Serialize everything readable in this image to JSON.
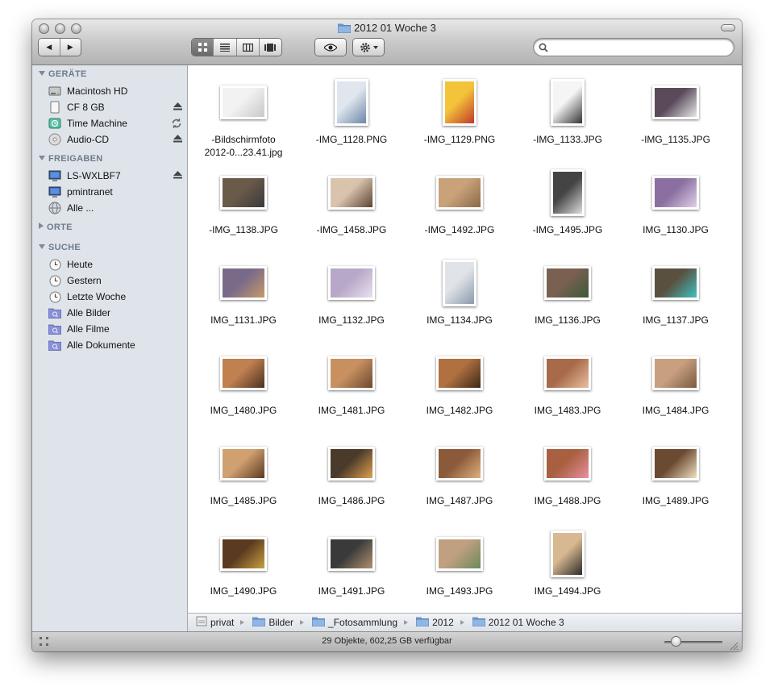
{
  "window": {
    "title": "2012 01 Woche 3",
    "search_placeholder": ""
  },
  "toolbar": {
    "back_glyph": "◀",
    "forward_glyph": "▶",
    "views": [
      "icon-view",
      "list-view",
      "column-view",
      "coverflow-view"
    ],
    "active_view": "icon-view",
    "quicklook_icon": "eye-icon",
    "action_icon": "gear-icon"
  },
  "sidebar": {
    "sections": [
      {
        "title": "GERÄTE",
        "expanded": true,
        "items": [
          {
            "label": "Macintosh HD",
            "icon": "harddisk-icon"
          },
          {
            "label": "CF 8 GB",
            "icon": "disk-icon",
            "accessory": "eject-icon"
          },
          {
            "label": "Time Machine",
            "icon": "timemachine-icon",
            "accessory": "sync-icon"
          },
          {
            "label": "Audio-CD",
            "icon": "cd-icon",
            "accessory": "eject-icon"
          }
        ]
      },
      {
        "title": "FREIGABEN",
        "expanded": true,
        "items": [
          {
            "label": "LS-WXLBF7",
            "icon": "network-display-icon",
            "accessory": "eject-icon"
          },
          {
            "label": "pmintranet",
            "icon": "network-display-icon"
          },
          {
            "label": "Alle ...",
            "icon": "network-globe-icon"
          }
        ]
      },
      {
        "title": "ORTE",
        "expanded": false,
        "items": []
      },
      {
        "title": "SUCHE",
        "expanded": true,
        "items": [
          {
            "label": "Heute",
            "icon": "clock-icon"
          },
          {
            "label": "Gestern",
            "icon": "clock-icon"
          },
          {
            "label": "Letzte Woche",
            "icon": "clock-icon"
          },
          {
            "label": "Alle Bilder",
            "icon": "smart-folder-icon"
          },
          {
            "label": "Alle Filme",
            "icon": "smart-folder-icon"
          },
          {
            "label": "Alle Dokumente",
            "icon": "smart-folder-icon"
          }
        ]
      }
    ]
  },
  "files": [
    {
      "name": "-Bildschirmfoto 2012-0...23.41.jpg",
      "line1": "-Bildschirmfoto",
      "line2": "2012-0...23.41.jpg",
      "orient": "landscape",
      "palette": [
        "#f2f2f2",
        "#c8c8c8"
      ]
    },
    {
      "name": "-IMG_1128.PNG",
      "orient": "portrait",
      "palette": [
        "#dfe6ee",
        "#6b86a8"
      ]
    },
    {
      "name": "-IMG_1129.PNG",
      "orient": "portrait",
      "palette": [
        "#f3c43a",
        "#c0392b"
      ]
    },
    {
      "name": "-IMG_1133.JPG",
      "orient": "portrait",
      "palette": [
        "#f5f5f5",
        "#333333"
      ]
    },
    {
      "name": "-IMG_1135.JPG",
      "orient": "landscape",
      "palette": [
        "#5a4a5a",
        "#e8e8e8"
      ]
    },
    {
      "name": "-IMG_1138.JPG",
      "orient": "landscape",
      "palette": [
        "#6a5a4a",
        "#3a3a3a"
      ]
    },
    {
      "name": "-IMG_1458.JPG",
      "orient": "landscape",
      "palette": [
        "#d9c3ad",
        "#5a4434"
      ]
    },
    {
      "name": "-IMG_1492.JPG",
      "orient": "landscape",
      "palette": [
        "#c9a27a",
        "#8a6a4a"
      ]
    },
    {
      "name": "-IMG_1495.JPG",
      "orient": "portrait",
      "palette": [
        "#444444",
        "#dddddd"
      ]
    },
    {
      "name": "IMG_1130.JPG",
      "orient": "landscape",
      "palette": [
        "#8a6fa0",
        "#e0d0e8"
      ]
    },
    {
      "name": "IMG_1131.JPG",
      "orient": "landscape",
      "palette": [
        "#7a6a8a",
        "#c49a6a"
      ]
    },
    {
      "name": "IMG_1132.JPG",
      "orient": "landscape",
      "palette": [
        "#b8a8c8",
        "#e8e0f0"
      ]
    },
    {
      "name": "IMG_1134.JPG",
      "orient": "portrait",
      "palette": [
        "#e0e4e8",
        "#8a9aaa"
      ]
    },
    {
      "name": "IMG_1136.JPG",
      "orient": "landscape",
      "palette": [
        "#7a6050",
        "#3a5a3a"
      ]
    },
    {
      "name": "IMG_1137.JPG",
      "orient": "landscape",
      "palette": [
        "#5a5040",
        "#40c0c0"
      ]
    },
    {
      "name": "IMG_1480.JPG",
      "orient": "landscape",
      "palette": [
        "#c08050",
        "#4a3020"
      ]
    },
    {
      "name": "IMG_1481.JPG",
      "orient": "landscape",
      "palette": [
        "#c89060",
        "#6a4a30"
      ]
    },
    {
      "name": "IMG_1482.JPG",
      "orient": "landscape",
      "palette": [
        "#b07040",
        "#3a2a1a"
      ]
    },
    {
      "name": "IMG_1483.JPG",
      "orient": "landscape",
      "palette": [
        "#a86a48",
        "#e8c0a0"
      ]
    },
    {
      "name": "IMG_1484.JPG",
      "orient": "landscape",
      "palette": [
        "#c8a080",
        "#7a5a40"
      ]
    },
    {
      "name": "IMG_1485.JPG",
      "orient": "landscape",
      "palette": [
        "#d0a070",
        "#5a3a20"
      ]
    },
    {
      "name": "IMG_1486.JPG",
      "orient": "landscape",
      "palette": [
        "#4a3a2a",
        "#e0a050"
      ]
    },
    {
      "name": "IMG_1487.JPG",
      "orient": "landscape",
      "palette": [
        "#8a5a3a",
        "#e0b080"
      ]
    },
    {
      "name": "IMG_1488.JPG",
      "orient": "landscape",
      "palette": [
        "#a86040",
        "#e890a0"
      ]
    },
    {
      "name": "IMG_1489.JPG",
      "orient": "landscape",
      "palette": [
        "#6a4a30",
        "#f0e0c0"
      ]
    },
    {
      "name": "IMG_1490.JPG",
      "orient": "landscape",
      "palette": [
        "#5a3a20",
        "#c8a040"
      ]
    },
    {
      "name": "IMG_1491.JPG",
      "orient": "landscape",
      "palette": [
        "#3a3a3a",
        "#b09070"
      ]
    },
    {
      "name": "IMG_1493.JPG",
      "orient": "landscape",
      "palette": [
        "#c0a080",
        "#6a8a5a"
      ]
    },
    {
      "name": "IMG_1494.JPG",
      "orient": "portrait",
      "palette": [
        "#d8b890",
        "#2a2a2a"
      ]
    }
  ],
  "pathbar": [
    {
      "label": "privat",
      "icon": "home-icon"
    },
    {
      "label": "Bilder",
      "icon": "folder-icon"
    },
    {
      "label": "_Fotosammlung",
      "icon": "folder-icon"
    },
    {
      "label": "2012",
      "icon": "folder-icon"
    },
    {
      "label": "2012 01 Woche 3",
      "icon": "folder-icon"
    }
  ],
  "status": {
    "text": "29 Objekte, 602,25 GB verfügbar",
    "icon_size_fraction": 0.2
  },
  "colors": {
    "sidebar_bg": "#dee4ea",
    "section_header": "#6e7b8b",
    "folder_blue": "#7fa7d8"
  }
}
